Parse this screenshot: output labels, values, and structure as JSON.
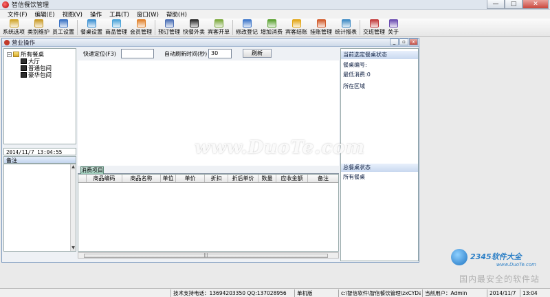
{
  "app": {
    "title": "智信餐饮管理"
  },
  "window_controls": {
    "minimize": "—",
    "maximize": "□",
    "close": "✕"
  },
  "menu": [
    {
      "label": "文件(F)"
    },
    {
      "label": "编辑(E)"
    },
    {
      "label": "视图(V)"
    },
    {
      "label": "操作"
    },
    {
      "label": "工具(T)"
    },
    {
      "label": "窗口(W)"
    },
    {
      "label": "帮助(H)"
    }
  ],
  "toolbar": [
    {
      "label": "系统选项",
      "icon": "key-icon",
      "color": "#d1a52a"
    },
    {
      "label": "类别维护",
      "icon": "key-icon",
      "color": "#c99a26"
    },
    {
      "label": "员工设置",
      "icon": "person-icon",
      "color": "#3a72c4"
    },
    {
      "label": "餐桌设置",
      "icon": "table-icon",
      "color": "#3a8fd1"
    },
    {
      "label": "商品管理",
      "icon": "bowl-icon",
      "color": "#4aa3d8"
    },
    {
      "label": "会员管理",
      "icon": "member-icon",
      "color": "#e0812b"
    },
    {
      "label": "预订管理",
      "icon": "book-icon",
      "color": "#4b6fb5"
    },
    {
      "label": "快餐外卖",
      "icon": "phone-icon",
      "color": "#2b2b2b"
    },
    {
      "label": "宾客开单",
      "icon": "open-bill-icon",
      "color": "#7aa83a"
    },
    {
      "label": "修改登记",
      "icon": "edit-person-icon",
      "color": "#3d76c9"
    },
    {
      "label": "增加消费",
      "icon": "add-consume-icon",
      "color": "#58a02e"
    },
    {
      "label": "宾客结账",
      "icon": "coin-icon",
      "color": "#e2a515"
    },
    {
      "label": "挂账管理",
      "icon": "ledger-person-icon",
      "color": "#d15a2a"
    },
    {
      "label": "统计报表",
      "icon": "report-icon",
      "color": "#3d8ac4"
    },
    {
      "label": "交班管理",
      "icon": "shift-icon",
      "color": "#c23b3b"
    },
    {
      "label": "关于",
      "icon": "help-icon",
      "color": "#6a4bb0"
    }
  ],
  "child_window": {
    "title": "营业操作",
    "controls": {
      "minimize": "_",
      "restore": "▫",
      "close": "x"
    }
  },
  "tree": {
    "root": "所有餐桌",
    "children": [
      "大厅",
      "普通包间",
      "豪华包间"
    ],
    "toggle": "−"
  },
  "datetime": "2014/11/7 13:04:55",
  "memo": {
    "header": "备注"
  },
  "quick_locate": {
    "label": "快速定位(F3)",
    "value": ""
  },
  "auto_refresh": {
    "label": "自动刷新时间(秒)",
    "value": "30"
  },
  "refresh_button": "刷新",
  "consume_tab": "消费项目",
  "grid_columns": [
    "商品编码",
    "商品名称",
    "单位",
    "单价",
    "折扣",
    "折后单价",
    "数量",
    "应收金额",
    "备注"
  ],
  "right_panel": {
    "current_header": "当前选定餐桌状态",
    "table_no": "餐桌编号:",
    "min_consume": "最低消费:0",
    "area": "所在区域",
    "total_header": "总餐桌状态",
    "all_tables": "所有餐桌"
  },
  "watermark": {
    "text": "www.DuoTe.com",
    "brand": "2345软件大全",
    "url": "www.DuoTe.com",
    "tagline": "国内最安全的软件站"
  },
  "statusbar": {
    "support": "技术支持电话：13694203350 QQ:137028956",
    "edition": "单机版",
    "path": "c:\\智信软件\\智信餐饮管理\\zxCYData.sys",
    "user": "当前用户：Admin",
    "date": "2014/11/7",
    "time": "13:04"
  }
}
